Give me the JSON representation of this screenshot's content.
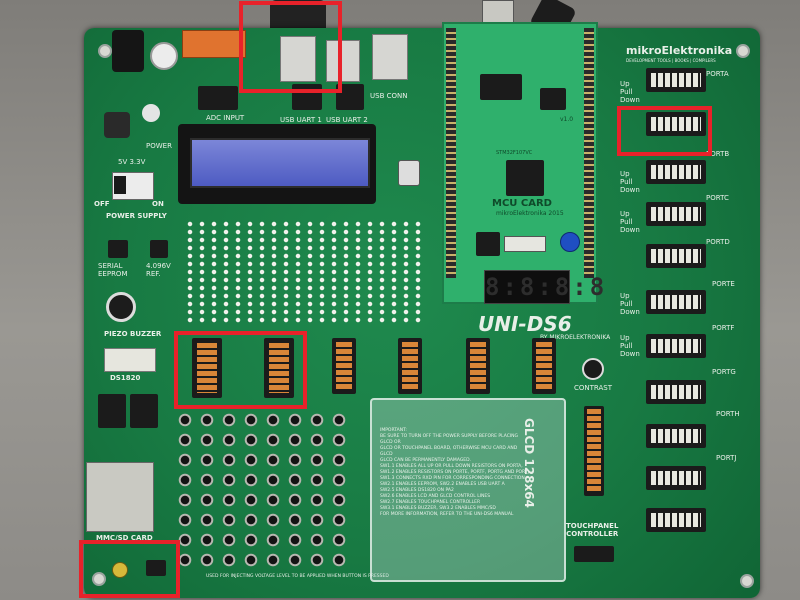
{
  "board": {
    "brand": "mikroElektronika",
    "brand_sub": "DEVELOPMENT TOOLS | BOOKS | COMPILERS",
    "name": "UNI-DS6",
    "by": "BY MIKROELEKTRONIKA"
  },
  "mcu_card": {
    "title": "MCU CARD",
    "brand": "mikroElektronika 2015",
    "version": "v1.0",
    "chip_label": "STM32F107VC"
  },
  "labels": {
    "power": "POWER",
    "supply_5v": "5V 3.3V",
    "supply_ext": "3.3V",
    "off": "OFF",
    "on": "ON",
    "power_supply": "POWER SUPPLY",
    "serial_eeprom": "SERIAL\nEEPROM",
    "ref": "4.096V\nREF.",
    "piezo": "PIEZO BUZZER",
    "ds1820": "DS1820",
    "mmc": "MMC/SD CARD",
    "usb_uart1": "USB UART 1",
    "usb_uart2": "USB UART 2",
    "usb_conn": "USB CONN",
    "adc_input": "ADC INPUT",
    "up_pull_down": "Up\nPull\nDown",
    "contrast": "CONTRAST",
    "touchpanel": "TOUCHPANEL\nCONTROLLER",
    "glcd": "GLCD 128x64",
    "bottom_note": "USED FOR INJECTING VOLTAGE LEVEL TO BE APPLIED WHEN BUTTON IS PRESSED",
    "ports": [
      "PORTA",
      "PORTB",
      "PORTC",
      "PORTD",
      "PORTE",
      "PORTF",
      "PORTG",
      "PORTH",
      "PORTJ"
    ],
    "seg_display": "8:8:8:8"
  },
  "glcd_text_lines": [
    "IMPORTANT:",
    "BE SURE TO TURN OFF THE POWER SUPPLY BEFORE PLACING GLCD OR",
    "GLCD OR TOUCHPANEL BOARD, OTHERWISE MCU CARD AND GLCD",
    "GLCD CAN BE PERMANENTLY DAMAGED.",
    "SW1.1 ENABLES ALL UP OR PULL DOWN RESISTORS ON PORTA,",
    "SW1.2 ENABLES RESISTORS ON PORTE, PORTF, PORTG AND PORTJ",
    "SW1.3 CONNECTS RXD PIN FOR CORRESPONDING CONNECTION",
    "SW2.1 ENABLES EEPROM, SW2.2 ENABLES USB UART A",
    "SW2.5 ENABLES DS1820 ON PA2",
    "SW2.6 ENABLES LCD AND GLCD CONTROL LINES",
    "SW2.7 ENABLES TOUCHPANEL CONTROLLER",
    "SW3.1 ENABLES BUZZER, SW3.2 ENABLES MMC/SD",
    "FOR MORE INFORMATION, REFER TO THE UNI-DS6 MANUAL"
  ],
  "colors": {
    "board_green": "#187a43",
    "mcu_card_green": "#2fb06c",
    "highlight_red": "#e8222a",
    "lcd_blue": "#5a68cc"
  },
  "highlights": [
    "usb-uart-connector-highlight",
    "port-b-dip-switch-highlight",
    "led-dip-switch-highlight",
    "mmc-card-button-highlight"
  ]
}
